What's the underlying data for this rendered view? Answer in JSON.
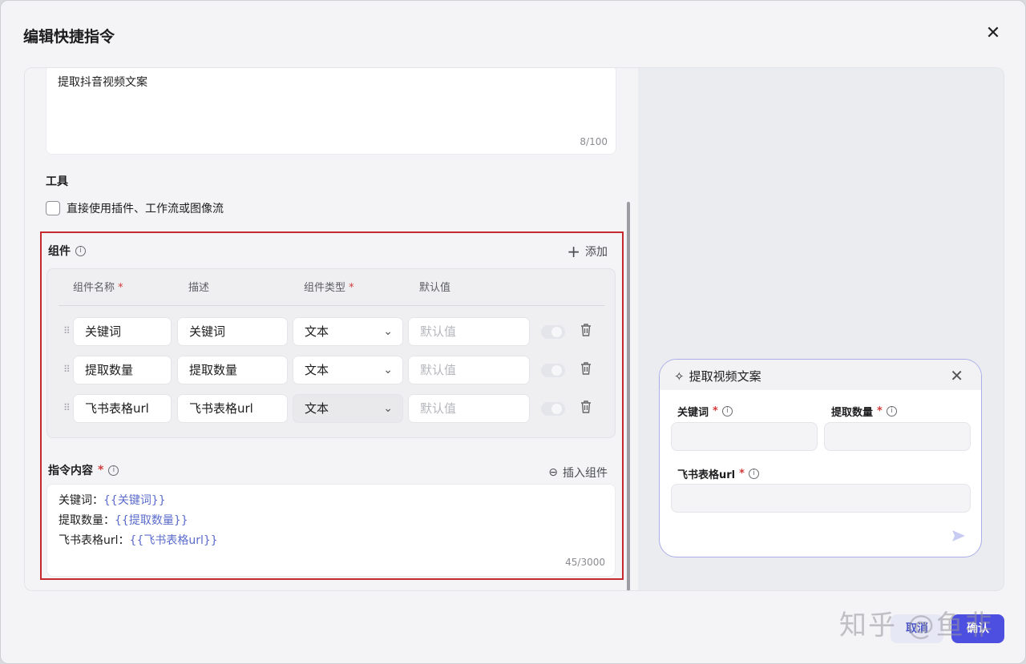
{
  "dialog": {
    "title": "编辑快捷指令",
    "close_icon": "close-icon"
  },
  "description": {
    "value": "提取抖音视频文案",
    "count": "8/100"
  },
  "tools": {
    "label": "工具",
    "checkbox_label": "直接使用插件、工作流或图像流",
    "checked": false
  },
  "components": {
    "label": "组件",
    "add_label": "添加",
    "headers": {
      "name": "组件名称",
      "desc": "描述",
      "type": "组件类型",
      "default": "默认值",
      "required_mark": "*"
    },
    "rows": [
      {
        "name": "关键词",
        "desc": "关键词",
        "type": "文本",
        "default_placeholder": "默认值"
      },
      {
        "name": "提取数量",
        "desc": "提取数量",
        "type": "文本",
        "default_placeholder": "默认值"
      },
      {
        "name": "飞书表格url",
        "desc": "飞书表格url",
        "type": "文本",
        "default_placeholder": "默认值"
      }
    ]
  },
  "instruction": {
    "label": "指令内容",
    "required_mark": "*",
    "insert_label": "插入组件",
    "lines": [
      {
        "prefix": "关键词：",
        "var": "{{关键词}}"
      },
      {
        "prefix": "提取数量：",
        "var": "{{提取数量}}"
      },
      {
        "prefix": "飞书表格url：",
        "var": "{{飞书表格url}}"
      }
    ],
    "count": "45/3000"
  },
  "preview": {
    "title": "提取视频文案",
    "fields": [
      {
        "label": "关键词",
        "required_mark": "*"
      },
      {
        "label": "提取数量",
        "required_mark": "*"
      },
      {
        "label": "飞书表格url",
        "required_mark": "*"
      }
    ]
  },
  "footer": {
    "cancel_label": "取消",
    "ok_label": "确认"
  },
  "watermark": "知乎 @鱼非",
  "colors": {
    "accent": "#4d4fe0",
    "highlight_border": "#c52a2f",
    "variable": "#5a6bcb"
  }
}
